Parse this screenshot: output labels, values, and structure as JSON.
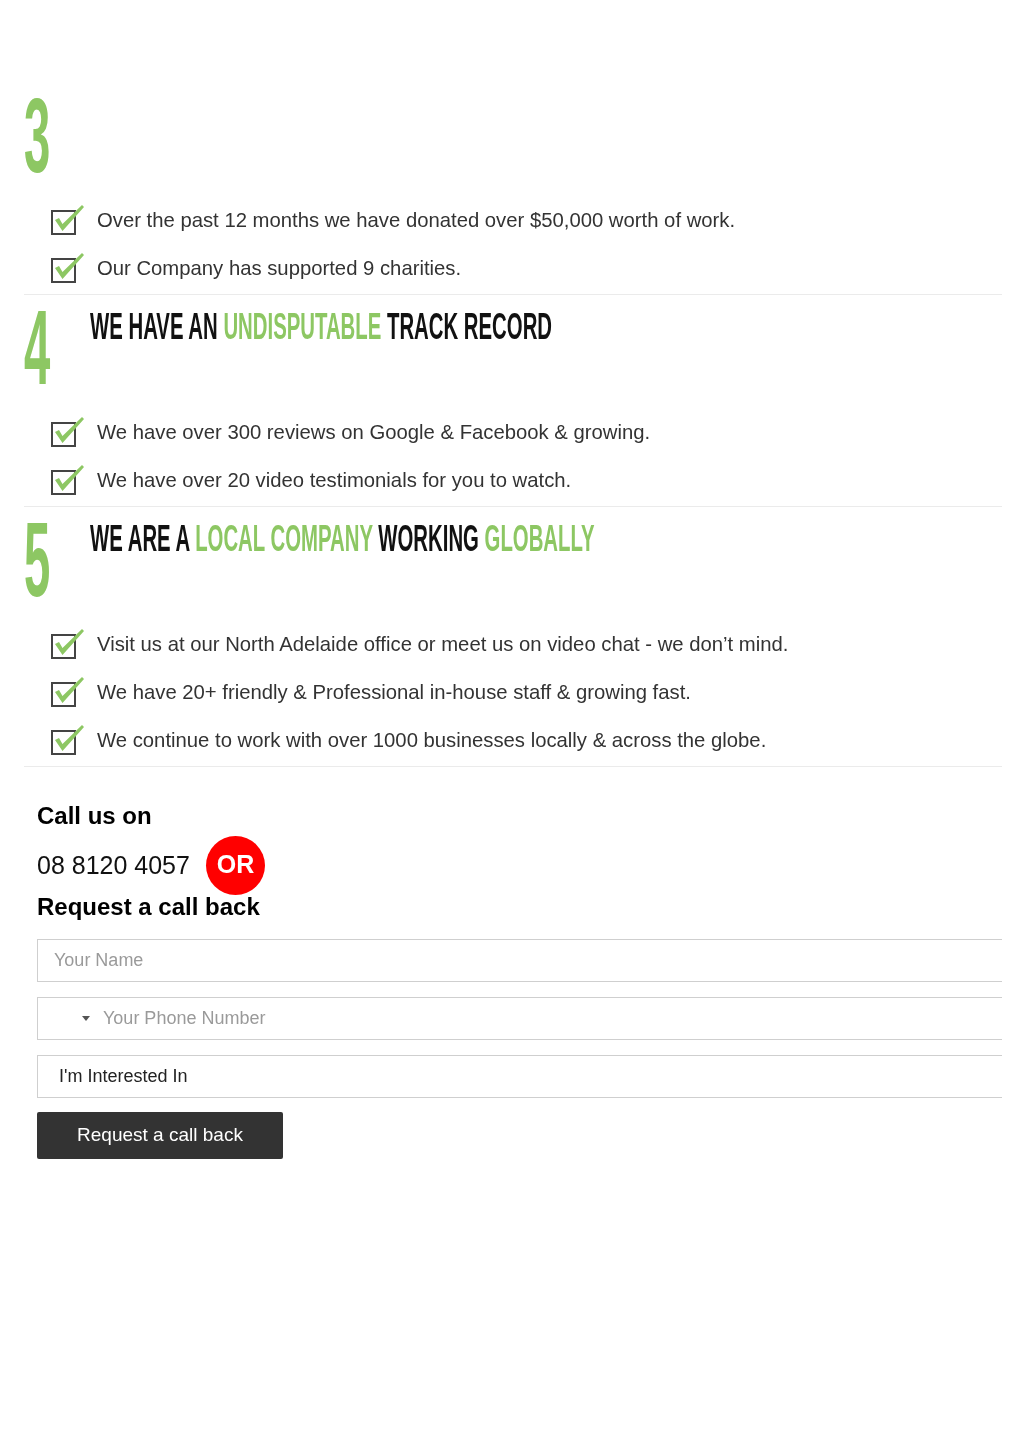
{
  "sections": [
    {
      "number": "3",
      "items": [
        "Over the past 12 months we have donated over $50,000 worth of work.",
        "Our Company has supported 9 charities."
      ]
    },
    {
      "number": "4",
      "heading": [
        {
          "text": "WE HAVE AN",
          "highlight": false
        },
        {
          "text": "UNDISPUTABLE",
          "highlight": true
        },
        {
          "text": "TRACK RECORD",
          "highlight": false
        }
      ],
      "items": [
        "We have over 300 reviews on Google & Facebook & growing.",
        "We have over 20 video testimonials for you to watch."
      ]
    },
    {
      "number": "5",
      "heading": [
        {
          "text": "WE ARE A",
          "highlight": false
        },
        {
          "text": "LOCAL COMPANY",
          "highlight": true
        },
        {
          "text": "WORKING",
          "highlight": false
        },
        {
          "text": "GLOBALLY",
          "highlight": true
        }
      ],
      "items": [
        "Visit us at our North Adelaide office or meet us on video chat - we don’t mind.",
        "We have 20+ friendly & Professional in-house staff & growing fast.",
        "We continue to work with over 1000 businesses locally & across the globe."
      ]
    }
  ],
  "contact": {
    "call_label": "Call us on",
    "phone": "08 8120 4057",
    "or_badge": "OR",
    "request_title": "Request a call back",
    "name_field": {
      "placeholder": "Your Name"
    },
    "phone_field": {
      "placeholder": "Your Phone Number"
    },
    "interest_select": {
      "value": "I'm Interested In"
    },
    "submit_button": "Request a call back"
  }
}
